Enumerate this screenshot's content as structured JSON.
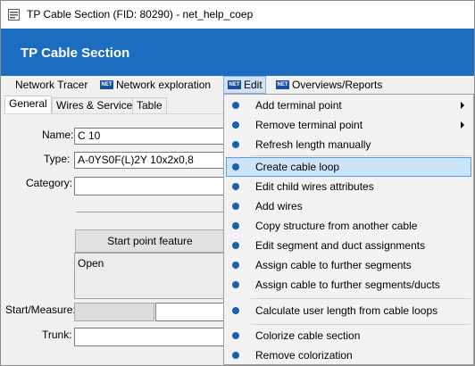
{
  "window": {
    "title": "TP Cable Section (FID: 80290) - net_help_coep",
    "header": "TP Cable Section"
  },
  "menubar": {
    "items": [
      {
        "label": "Network Tracer",
        "badge": ""
      },
      {
        "label": "Network exploration",
        "badge": "NET"
      },
      {
        "label": "Edit",
        "badge": "NET"
      },
      {
        "label": "Overviews/Reports",
        "badge": "NET"
      }
    ]
  },
  "tabs": [
    "General",
    "Wires & Services",
    "Table"
  ],
  "form": {
    "name_label": "Name:",
    "name_value": "C 10",
    "type_label": "Type:",
    "type_value": "A-0YS0F(L)2Y 10x2x0,8",
    "category_label": "Category:",
    "category_value": "",
    "start_point_button": "Start point feature",
    "start_point_status": "Open",
    "start_measure_label": "Start/Measure:",
    "trunk_label": "Trunk:"
  },
  "edit_menu": {
    "items": [
      {
        "label": "Add terminal point",
        "submenu": true
      },
      {
        "label": "Remove terminal point",
        "submenu": true
      },
      {
        "label": "Refresh length manually",
        "submenu": false
      },
      {
        "label": "Create cable loop",
        "submenu": false,
        "highlighted": true
      },
      {
        "label": "Edit child wires attributes",
        "submenu": false
      },
      {
        "label": "Add wires",
        "submenu": false
      },
      {
        "label": "Copy structure from another cable",
        "submenu": false
      },
      {
        "label": "Edit segment and duct assignments",
        "submenu": false
      },
      {
        "label": "Assign cable to further segments",
        "submenu": false
      },
      {
        "label": "Assign cable to further segments/ducts",
        "submenu": false
      },
      {
        "label": "Calculate user length from cable loops",
        "submenu": false
      },
      {
        "label": "Colorize cable section",
        "submenu": false
      },
      {
        "label": "Remove colorization",
        "submenu": false
      }
    ]
  },
  "colors": {
    "header_blue": "#1c6cbf",
    "bullet_blue": "#1d5ea8",
    "highlight": "#cce4f7"
  }
}
